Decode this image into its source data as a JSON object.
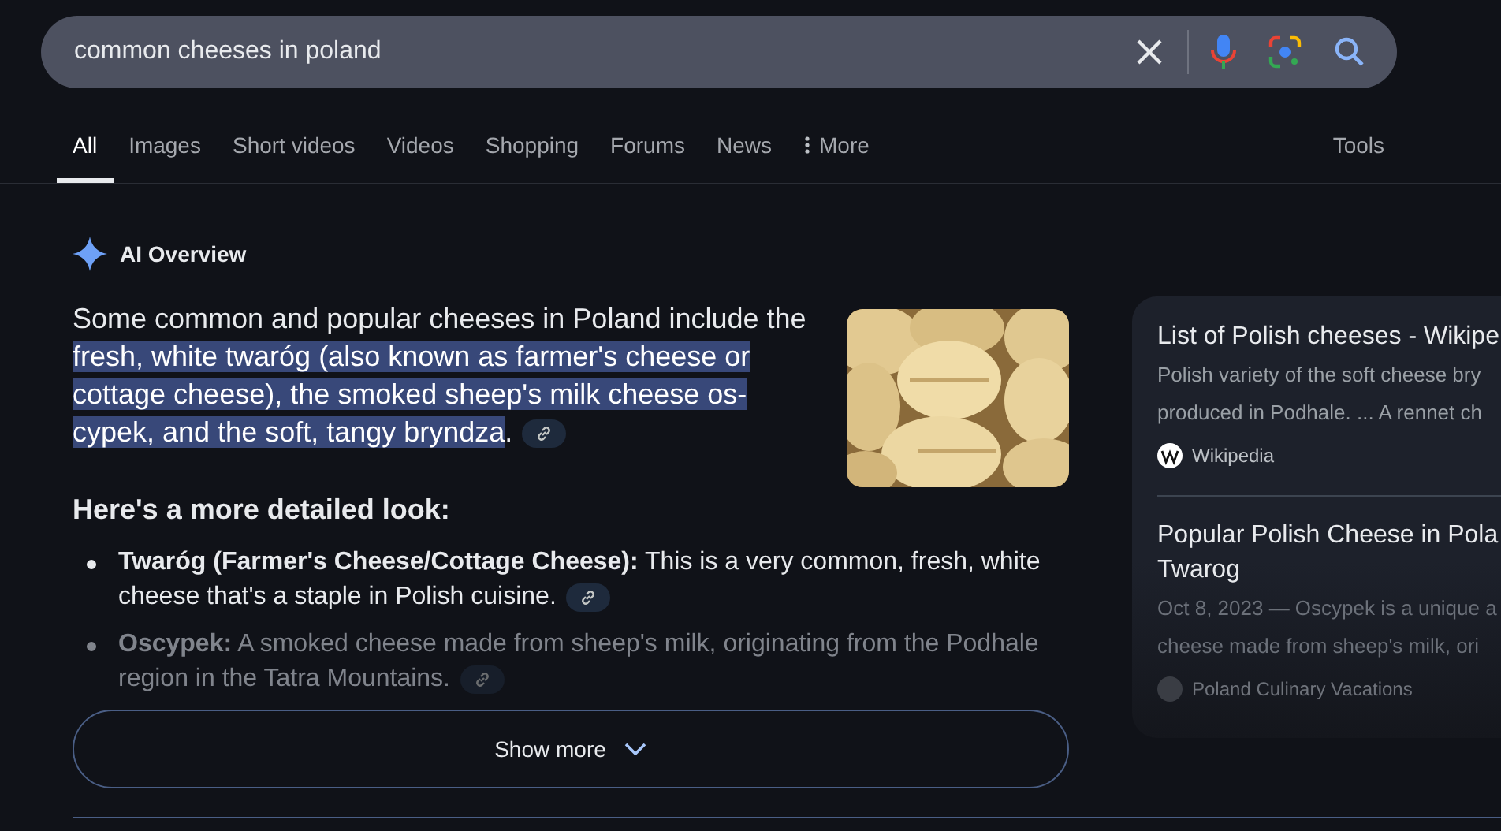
{
  "search": {
    "value": "common cheeses in poland"
  },
  "tabs": [
    {
      "label": "All",
      "selected": true
    },
    {
      "label": "Images",
      "selected": false
    },
    {
      "label": "Short videos",
      "selected": false
    },
    {
      "label": "Videos",
      "selected": false
    },
    {
      "label": "Shopping",
      "selected": false
    },
    {
      "label": "Forums",
      "selected": false
    },
    {
      "label": "News",
      "selected": false
    },
    {
      "label": "More",
      "selected": false,
      "kind": "menu"
    }
  ],
  "tools": "Tools",
  "overview": {
    "title": "AI Overview",
    "summary": [
      {
        "text": "Some common and popular cheeses in Poland include the ",
        "highlighted": false
      },
      {
        "text": "fresh, white twaróg (also known as farmer's cheese or cottage cheese), the smoked sheep's milk cheese os-cypek, and the soft, tangy bryndza",
        "highlighted": true
      },
      {
        "text": ".",
        "highlighted": false
      }
    ],
    "heading": "Here's a more detailed look:",
    "items": [
      {
        "text": "**Twaróg (Farmer's Cheese/Cottage Cheese):** This is a very common, fresh, white cheese that's a staple in Polish cuisine."
      },
      {
        "text": "**Oscypek:** A smoked cheese made from sheep's milk, originating from the Podhale region in the Tatra Mountains."
      }
    ],
    "show_more": "Show more"
  },
  "sources": [
    {
      "title": "List of Polish cheeses - Wikipe",
      "snippet": [
        "Polish variety of the soft cheese bry",
        "produced in Podhale. ... A rennet ch"
      ],
      "site": "Wikipedia",
      "kind": "wiki"
    },
    {
      "title": "Popular Polish Cheese in Pola Twarog",
      "snippet": [
        "Oct 8, 2023 — Oscypek is a unique a",
        "cheese made from sheep's milk, ori"
      ],
      "site": "Poland Culinary Vacations",
      "kind": "plain"
    }
  ]
}
